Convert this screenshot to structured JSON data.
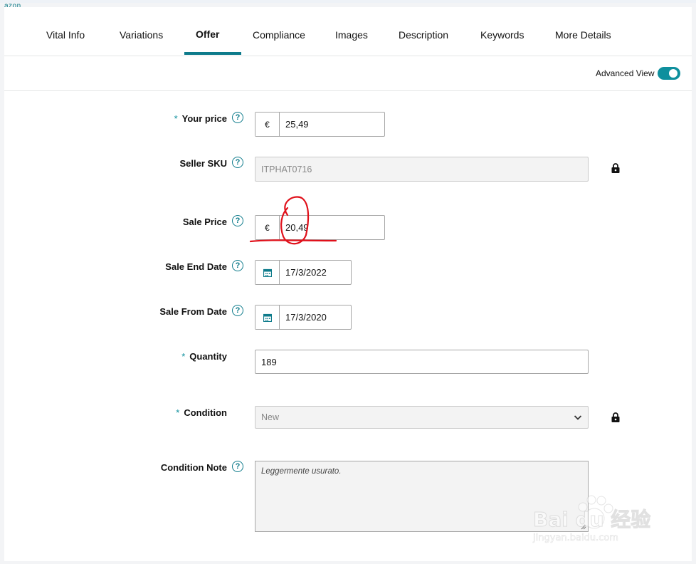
{
  "header": {
    "brand_fragment": "azon"
  },
  "tabs": [
    {
      "label": "Vital Info"
    },
    {
      "label": "Variations"
    },
    {
      "label": "Offer"
    },
    {
      "label": "Compliance"
    },
    {
      "label": "Images"
    },
    {
      "label": "Description"
    },
    {
      "label": "Keywords"
    },
    {
      "label": "More Details"
    }
  ],
  "active_tab": "Offer",
  "advanced_view": {
    "label": "Advanced View",
    "enabled": true
  },
  "form": {
    "your_price": {
      "label": "Your price",
      "required": true,
      "currency": "€",
      "value": "25,49"
    },
    "seller_sku": {
      "label": "Seller SKU",
      "value": "ITPHAT0716",
      "locked": true
    },
    "sale_price": {
      "label": "Sale Price",
      "currency": "€",
      "value": "20,49"
    },
    "sale_end_date": {
      "label": "Sale End Date",
      "value": "17/3/2022"
    },
    "sale_from_date": {
      "label": "Sale From Date",
      "value": "17/3/2020"
    },
    "quantity": {
      "label": "Quantity",
      "required": true,
      "value": "189"
    },
    "condition": {
      "label": "Condition",
      "required": true,
      "value": "New",
      "locked": true
    },
    "condition_note": {
      "label": "Condition Note",
      "value": "Leggermente usurato."
    }
  },
  "required_marker": "*",
  "help_glyph": "?",
  "watermark": {
    "brand": "Bai du 经验",
    "url": "jingyan.baidu.com"
  },
  "colors": {
    "accent": "#0e7b8b",
    "annotation": "#e0101a"
  }
}
